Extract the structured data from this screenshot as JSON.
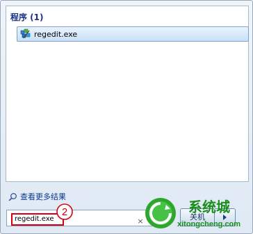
{
  "results": {
    "group_header": "程序 (1)",
    "items": [
      {
        "label": "regedit.exe",
        "icon": "regedit-icon"
      }
    ]
  },
  "see_more": {
    "label": "查看更多结果",
    "icon": "search-icon"
  },
  "search": {
    "value": "regedit.exe",
    "clear_glyph": "×"
  },
  "annotation": {
    "step_number": "2"
  },
  "power": {
    "shutdown_label": "关机",
    "arrow_icon": "arrow-right-icon"
  },
  "watermark": {
    "brand_text": "系统城",
    "url": "xitongcheng.com",
    "colors": {
      "green": "#2fa52f",
      "dark_green": "#1b8f1b"
    }
  },
  "colors": {
    "accent": "#1e3287",
    "highlight_border": "#7da2ce",
    "annotation_red": "#d8000f"
  }
}
